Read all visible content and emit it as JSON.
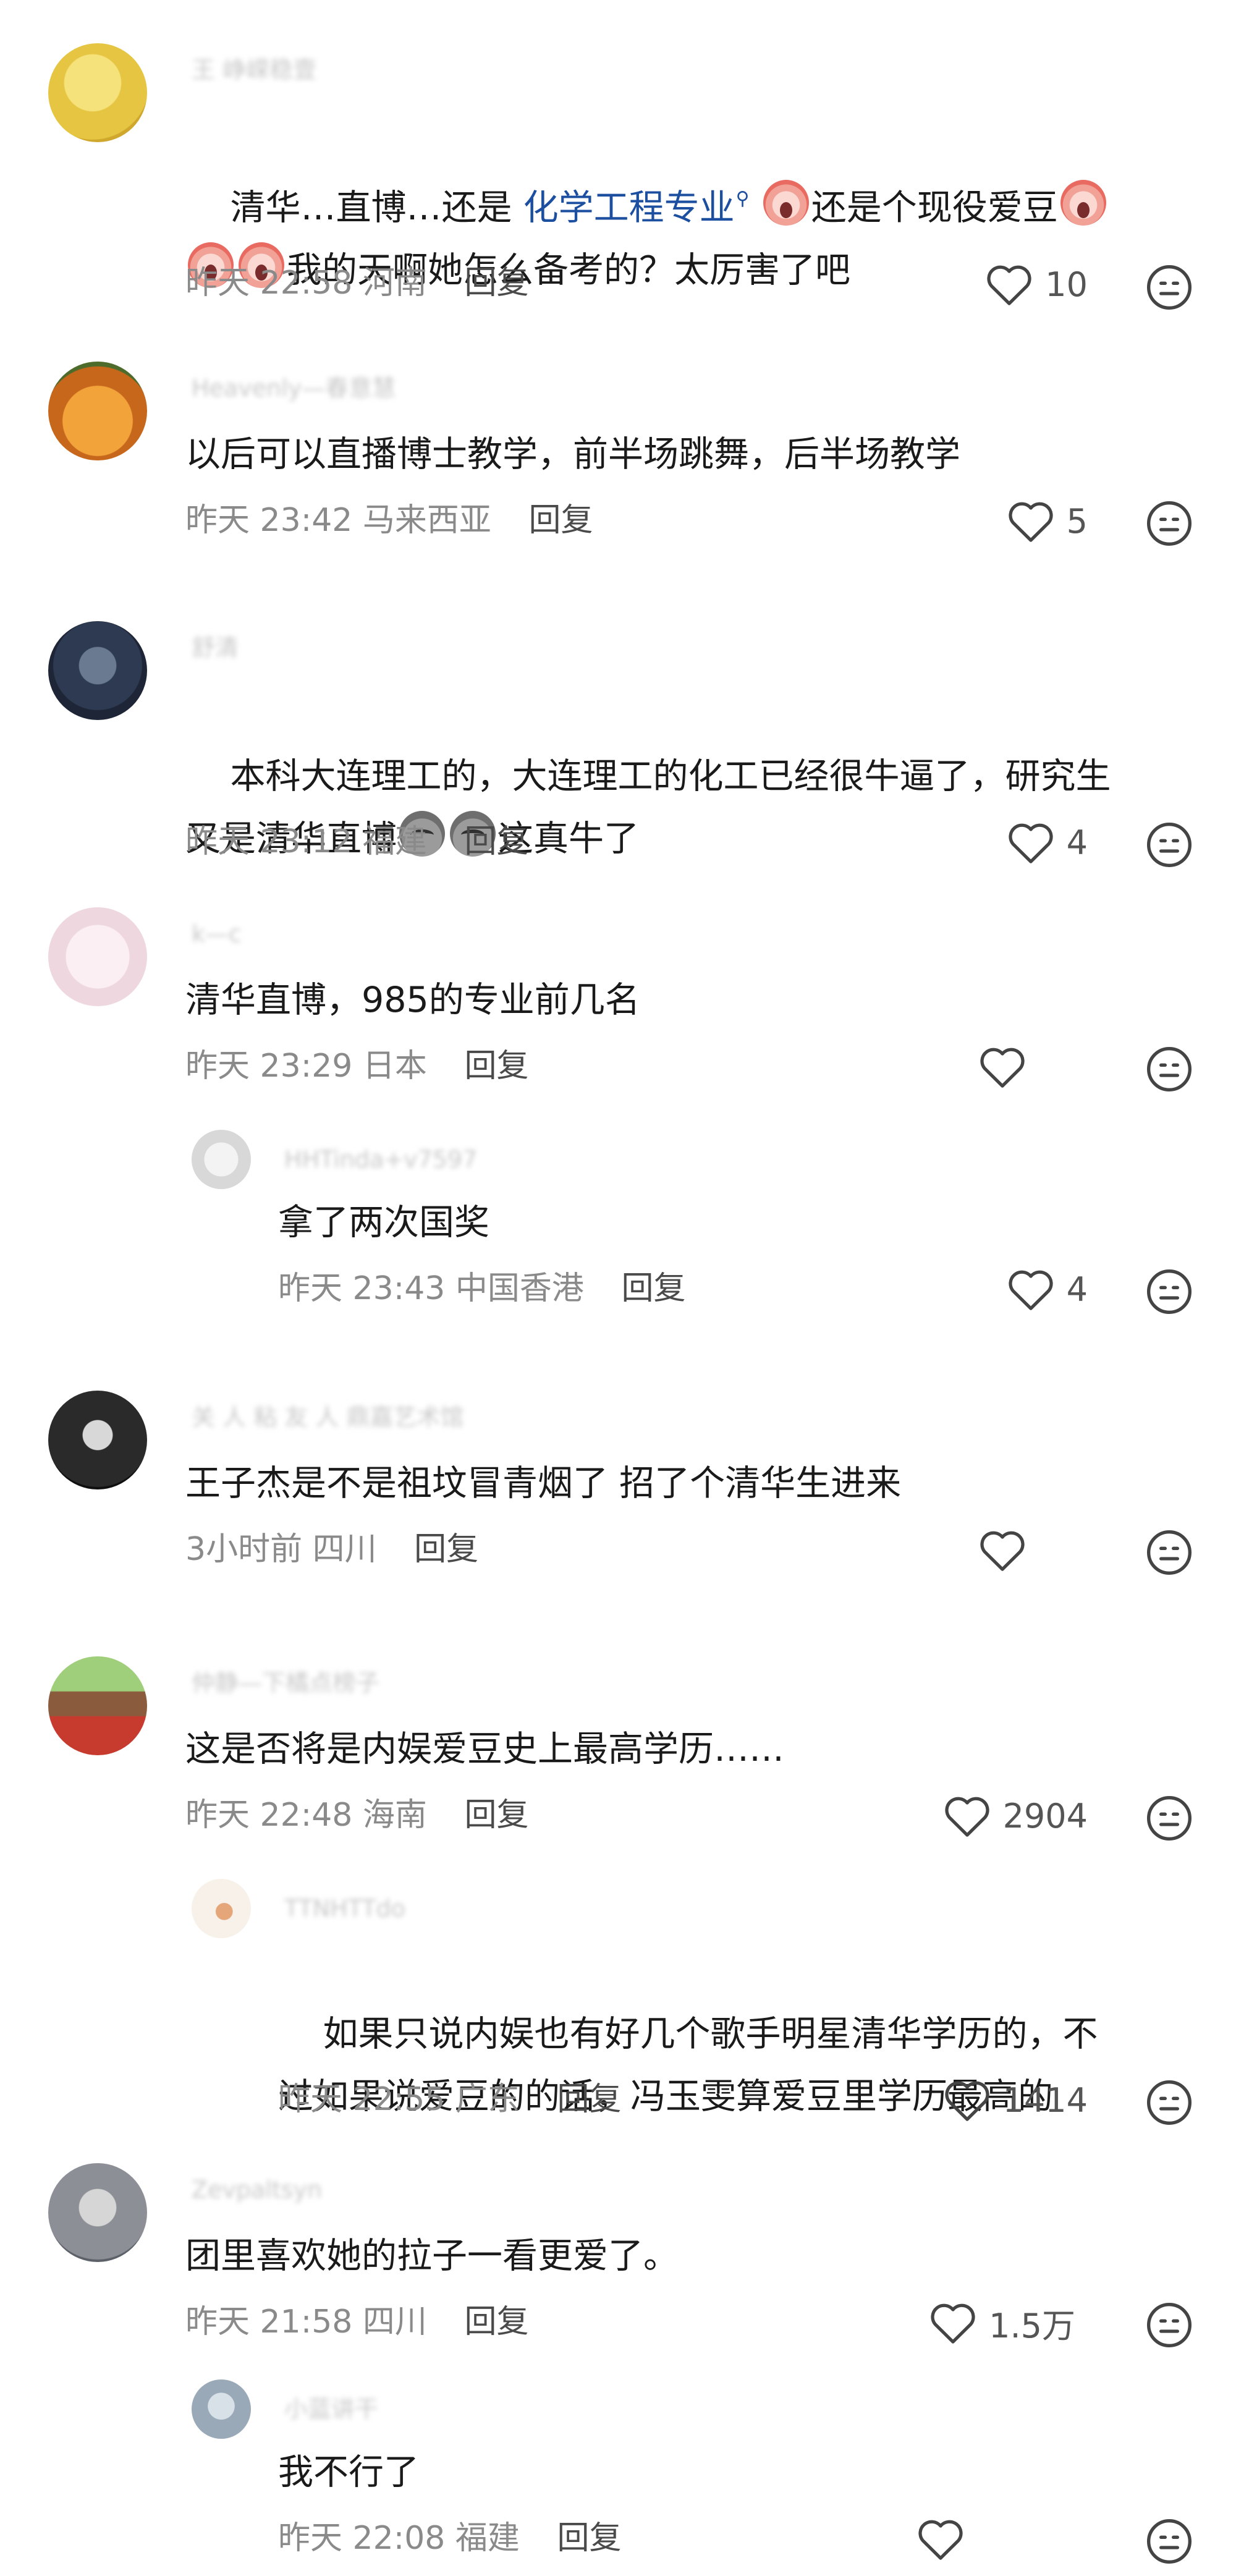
{
  "comments": [
    {
      "name": "王 峥嵘稳壹",
      "text_parts": {
        "a": "清华…直博…还是 ",
        "link": "化学工程专业",
        "b": "还是个现役爱豆",
        "c": "我的天啊她怎么备考的？太厉害了吧"
      },
      "time": "昨天 22:58",
      "location": "河南",
      "reply": "回复",
      "likes": "10",
      "avatar_color": "#e9c94a"
    },
    {
      "name": "Heavenly—春意慧",
      "text": "以后可以直播博士教学，前半场跳舞，后半场教学",
      "time": "昨天 23:42",
      "location": "马来西亚",
      "reply": "回复",
      "likes": "5",
      "avatar_color": "#d9822b"
    },
    {
      "name": "舒清",
      "text_line1": "本科大连理工的，大连理工的化工已经很牛逼了，研究生",
      "text_line2_a": "又是清华直博",
      "text_line2_b": "这真牛了",
      "time": "昨天 23:12",
      "location": "福建",
      "reply": "回复",
      "likes": "4",
      "avatar_color": "#2d3a52"
    },
    {
      "name": "k—c",
      "text": "清华直博，985的专业前几名",
      "time": "昨天 23:29",
      "location": "日本",
      "reply": "回复",
      "likes": "",
      "avatar_color": "#f1e6ea",
      "replies": [
        {
          "name": "HHTinda+v7597",
          "text": "拿了两次国奖",
          "time": "昨天 23:43",
          "location": "中国香港",
          "reply": "回复",
          "likes": "4",
          "avatar_color": "#e7e7e7"
        }
      ]
    },
    {
      "name": "关 人 粘 友 人 鼎嘉艺术馆",
      "text": "王子杰是不是祖坟冒青烟了 招了个清华生进来",
      "time": "3小时前",
      "location": "四川",
      "reply": "回复",
      "likes": "",
      "avatar_color": "#1e1e1e"
    },
    {
      "name": "仲静—下橘点榜子",
      "text": "这是否将是内娱爱豆史上最高学历……",
      "time": "昨天 22:48",
      "location": "海南",
      "reply": "回复",
      "likes": "2904",
      "avatar_color": "#c73b2e",
      "replies": [
        {
          "name": "TTNHTTdo",
          "text_line1": "如果只说内娱也有好几个歌手明星清华学历的，不",
          "text_line2": "过如果说爱豆的的话，冯玉雯算爱豆里学历最高的",
          "time": "昨天 22:55",
          "location": "广东",
          "reply": "回复",
          "likes": "1414",
          "avatar_color": "#f5efe6"
        }
      ]
    },
    {
      "name": "Zevpaltsyn",
      "text": "团里喜欢她的拉子一看更爱了。",
      "time": "昨天 21:58",
      "location": "四川",
      "reply": "回复",
      "likes": "1.5万",
      "avatar_color": "#8c8f96",
      "replies": [
        {
          "name": "小蓝讲干",
          "text": "我不行了",
          "time": "昨天 22:08",
          "location": "福建",
          "reply": "回复",
          "likes": "",
          "avatar_color": "#9aa9b8"
        }
      ]
    }
  ],
  "icons": {
    "like": "heart-outline-icon",
    "more": "neutral-face-icon",
    "search": "search-icon"
  },
  "colors": {
    "link": "#1c4fa0",
    "meta": "#8a8a8a",
    "text": "#1a1a1a"
  }
}
